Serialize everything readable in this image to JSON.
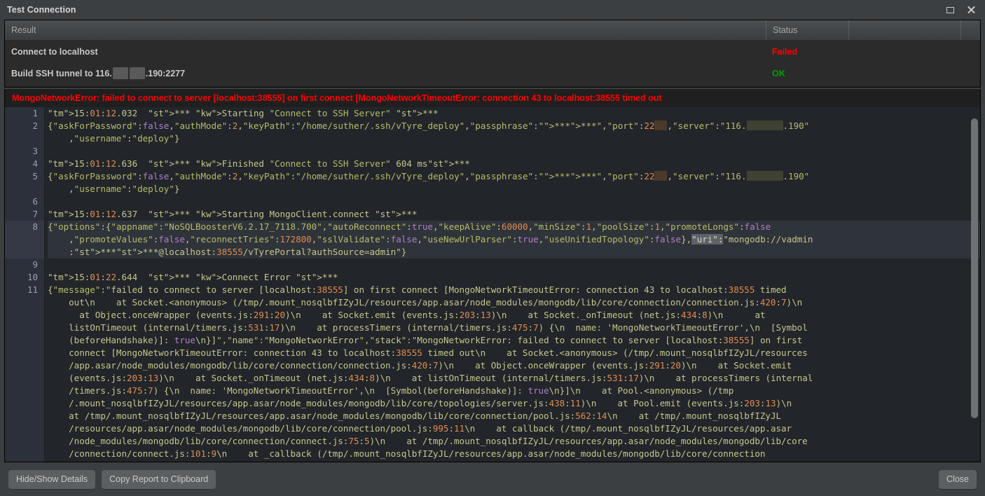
{
  "window": {
    "title": "Test Connection",
    "restore_icon": "restore-icon",
    "close_icon": "close-icon"
  },
  "table": {
    "headers": [
      "Result",
      "Status",
      "",
      ""
    ],
    "rows": [
      {
        "result": "Connect to localhost",
        "status": "Failed",
        "status_color": "#ff0000",
        "redacted": false
      },
      {
        "result_pre": "Build SSH tunnel to 116.",
        "result_post": ".190:2277",
        "status": "OK",
        "status_color": "#00a000",
        "redacted": true
      }
    ]
  },
  "error_banner": {
    "text": "MongoNetworkError: failed to connect to server [localhost:38555] on first connect [MongoNetworkTimeoutError: connection 43 to localhost:38555 timed out",
    "color": "#ff0000"
  },
  "log": {
    "line_numbers": [
      "1",
      "2",
      "",
      "3",
      "4",
      "5",
      "",
      "6",
      "7",
      "8",
      "",
      "",
      "9",
      "10",
      "11",
      "",
      "",
      "",
      "",
      "",
      "",
      "",
      "",
      "",
      "",
      "",
      "",
      "",
      "",
      ""
    ],
    "lines": [
      {
        "n": 1,
        "text": "15:01:12.032  *** Starting \"Connect to SSH Server\" ***"
      },
      {
        "n": 2,
        "text": "{\"askForPassword\":false,\"authMode\":2,\"keyPath\":\"/home/suther/.ssh/vTyre_deploy\",\"passphrase\":\"******\",\"port\":22  ,\"server\":\"116.      .190\""
      },
      {
        "n": 2,
        "text": "    ,\"username\":\"deploy\"}"
      },
      {
        "n": 3,
        "text": ""
      },
      {
        "n": 4,
        "text": "15:01:12.636  *** Finished \"Connect to SSH Server\" 604 ms***"
      },
      {
        "n": 5,
        "text": "{\"askForPassword\":false,\"authMode\":2,\"keyPath\":\"/home/suther/.ssh/vTyre_deploy\",\"passphrase\":\"******\",\"port\":22  ,\"server\":\"116.      .190\""
      },
      {
        "n": 5,
        "text": "    ,\"username\":\"deploy\"}"
      },
      {
        "n": 6,
        "text": ""
      },
      {
        "n": 7,
        "text": "15:01:12.637  *** Starting MongoClient.connect ***"
      },
      {
        "n": 8,
        "text": "{\"options\":{\"appname\":\"NoSQLBoosterV6.2.17_7118.700\",\"autoReconnect\":true,\"keepAlive\":60000,\"minSize\":1,\"poolSize\":1,\"promoteLongs\":false"
      },
      {
        "n": 8,
        "text": "    ,\"promoteValues\":false,\"reconnectTries\":172800,\"sslValidate\":false,\"useNewUrlParser\":true,\"useUnifiedTopology\":false},\"uri\":\"mongodb://vadmin"
      },
      {
        "n": 8,
        "text": "    :******@localhost:38555/vTyrePortal?authSource=admin\"}"
      },
      {
        "n": 9,
        "text": ""
      },
      {
        "n": 10,
        "text": "15:01:22.644  *** Connect Error ***"
      },
      {
        "n": 11,
        "text": "{\"message\":\"failed to connect to server [localhost:38555] on first connect [MongoNetworkTimeoutError: connection 43 to localhost:38555 timed"
      },
      {
        "n": 11,
        "text": "    out\\n    at Socket.<anonymous> (/tmp/.mount_nosqlbfIZyJL/resources/app.asar/node_modules/mongodb/lib/core/connection/connection.js:420:7)\\n"
      },
      {
        "n": 11,
        "text": "      at Object.onceWrapper (events.js:291:20)\\n    at Socket.emit (events.js:203:13)\\n    at Socket._onTimeout (net.js:434:8)\\n      at"
      },
      {
        "n": 11,
        "text": "    listOnTimeout (internal/timers.js:531:17)\\n    at processTimers (internal/timers.js:475:7) {\\n  name: 'MongoNetworkTimeoutError',\\n  [Symbol"
      },
      {
        "n": 11,
        "text": "    (beforeHandshake)]: true\\n}]\",\"name\":\"MongoNetworkError\",\"stack\":\"MongoNetworkError: failed to connect to server [localhost:38555] on first"
      },
      {
        "n": 11,
        "text": "    connect [MongoNetworkTimeoutError: connection 43 to localhost:38555 timed out\\n    at Socket.<anonymous> (/tmp/.mount_nosqlbfIZyJL/resources"
      },
      {
        "n": 11,
        "text": "    /app.asar/node_modules/mongodb/lib/core/connection/connection.js:420:7)\\n    at Object.onceWrapper (events.js:291:20)\\n    at Socket.emit"
      },
      {
        "n": 11,
        "text": "    (events.js:203:13)\\n    at Socket._onTimeout (net.js:434:8)\\n    at listOnTimeout (internal/timers.js:531:17)\\n    at processTimers (internal"
      },
      {
        "n": 11,
        "text": "    /timers.js:475:7) {\\n  name: 'MongoNetworkTimeoutError',\\n  [Symbol(beforeHandshake)]: true\\n}]\\n    at Pool.<anonymous> (/tmp"
      },
      {
        "n": 11,
        "text": "    /.mount_nosqlbfIZyJL/resources/app.asar/node_modules/mongodb/lib/core/topologies/server.js:438:11)\\n    at Pool.emit (events.js:203:13)\\n"
      },
      {
        "n": 11,
        "text": "    at /tmp/.mount_nosqlbfIZyJL/resources/app.asar/node_modules/mongodb/lib/core/connection/pool.js:562:14\\n    at /tmp/.mount_nosqlbfIZyJL"
      },
      {
        "n": 11,
        "text": "    /resources/app.asar/node_modules/mongodb/lib/core/connection/pool.js:995:11\\n    at callback (/tmp/.mount_nosqlbfIZyJL/resources/app.asar"
      },
      {
        "n": 11,
        "text": "    /node_modules/mongodb/lib/core/connection/connect.js:75:5)\\n    at /tmp/.mount_nosqlbfIZyJL/resources/app.asar/node_modules/mongodb/lib/core"
      },
      {
        "n": 11,
        "text": "    /connection/connect.js:101:9\\n    at _callback (/tmp/.mount_nosqlbfIZyJL/resources/app.asar/node_modules/mongodb/lib/core/connection"
      }
    ],
    "selection": "\"uri\":"
  },
  "footer": {
    "hide_show_details": "Hide/Show Details",
    "copy_report": "Copy Report to Clipboard",
    "close": "Close"
  }
}
